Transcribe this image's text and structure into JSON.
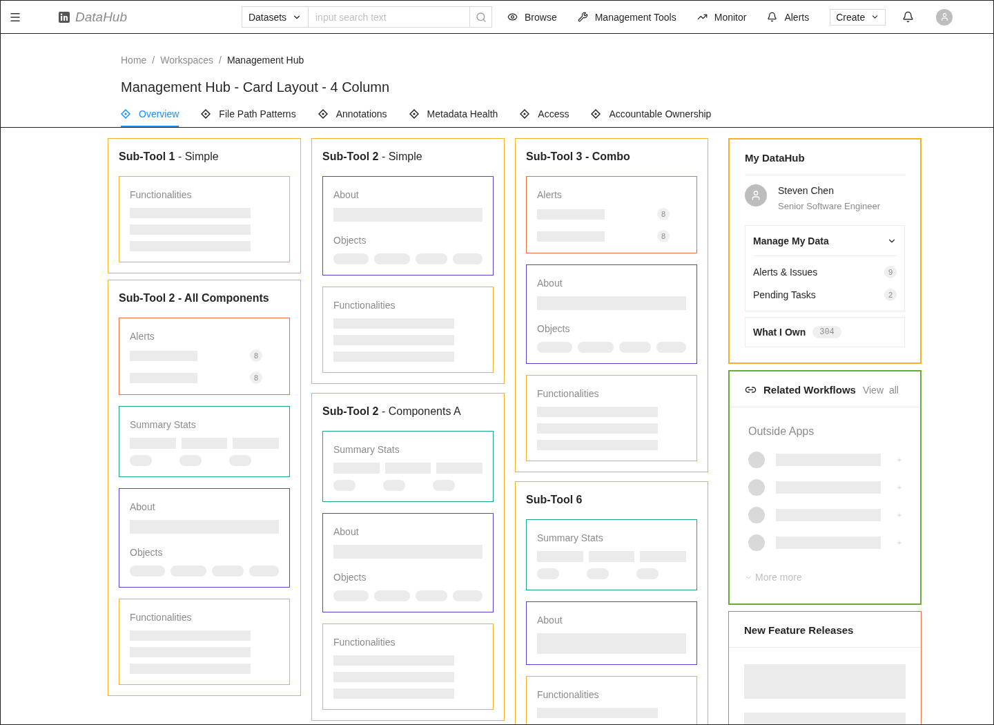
{
  "header": {
    "logo_text": "DataHub",
    "search": {
      "scope": "Datasets",
      "placeholder": "input search text"
    },
    "nav": [
      {
        "label": "Browse"
      },
      {
        "label": "Management Tools"
      },
      {
        "label": "Monitor"
      },
      {
        "label": "Alerts"
      }
    ],
    "create_label": "Create"
  },
  "breadcrumb": [
    {
      "label": "Home",
      "separator": "/"
    },
    {
      "label": "Workspaces",
      "separator": "/"
    },
    {
      "label": "Management Hub"
    }
  ],
  "page_title": "Management Hub - Card Layout - 4 Column",
  "tabs": [
    {
      "label": "Overview",
      "selected": true
    },
    {
      "label": "File Path Patterns",
      "selected": false
    },
    {
      "label": "Annotations",
      "selected": false
    },
    {
      "label": "Metadata Health",
      "selected": false
    },
    {
      "label": "Access",
      "selected": false
    },
    {
      "label": "Accountable Ownership",
      "selected": false
    }
  ],
  "columns": [
    {
      "cards": [
        {
          "title": "**Sub-Tool 1** - Simple",
          "widgets": [
            {
              "kind": "functionalities",
              "label": "Functionalities"
            }
          ]
        },
        {
          "title": "**Sub-Tool 2 - All Components**",
          "widgets": [
            {
              "kind": "alerts",
              "label": "Alerts",
              "counts": [
                "8",
                "8"
              ]
            },
            {
              "kind": "summary",
              "label": "Summary Stats"
            },
            {
              "kind": "about",
              "label": "About",
              "objects_label": "Objects"
            },
            {
              "kind": "functionalities",
              "label": "Functionalities"
            }
          ]
        }
      ]
    },
    {
      "cards": [
        {
          "title": "**Sub-Tool 2** - Simple",
          "widgets": [
            {
              "kind": "about",
              "label": "About",
              "objects_label": "Objects"
            },
            {
              "kind": "functionalities",
              "label": "Functionalities"
            }
          ]
        },
        {
          "title": "**Sub-Tool 2** - Components A",
          "widgets": [
            {
              "kind": "summary",
              "label": "Summary Stats"
            },
            {
              "kind": "about",
              "label": "About",
              "objects_label": "Objects"
            },
            {
              "kind": "functionalities",
              "label": "Functionalities"
            }
          ]
        }
      ]
    },
    {
      "cards": [
        {
          "title": "**Sub-Tool 3 - Combo**",
          "widgets": [
            {
              "kind": "alerts",
              "label": "Alerts",
              "counts": [
                "8",
                "8"
              ]
            },
            {
              "kind": "about",
              "label": "About",
              "objects_label": "Objects"
            },
            {
              "kind": "functionalities",
              "label": "Functionalities"
            }
          ]
        },
        {
          "title": "**Sub-Tool 6**",
          "widgets": [
            {
              "kind": "summary",
              "label": "Summary Stats"
            },
            {
              "kind": "about",
              "label": "About"
            },
            {
              "kind": "functionalities",
              "label": "Functionalities"
            }
          ]
        }
      ]
    }
  ],
  "my_datahub": {
    "title": "My DataHub",
    "name": "Steven Chen",
    "role": "Senior Software Engineer",
    "manage": {
      "title": "Manage My Data",
      "expanded": true,
      "items": [
        {
          "label": "Alerts & Issues",
          "count": "9"
        },
        {
          "label": "Pending Tasks",
          "count": "2"
        }
      ]
    },
    "own": {
      "label": "What I Own",
      "count": "304"
    }
  },
  "related_workflows": {
    "title": "Related Workflows",
    "view_all": "View all",
    "section": "Outside Apps",
    "more": "More more"
  },
  "new_features": {
    "title": "New Feature Releases"
  }
}
